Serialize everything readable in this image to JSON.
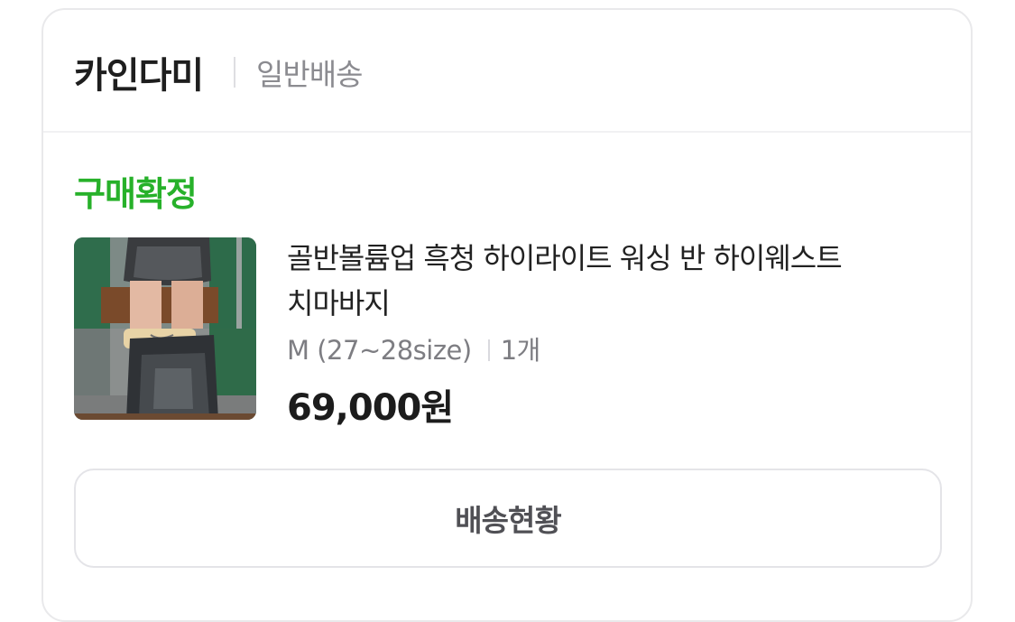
{
  "seller": {
    "name": "카인다미",
    "shipping_type": "일반배송"
  },
  "order": {
    "status": "구매확정",
    "status_color": "#27b12a",
    "product": {
      "name": "골반볼륨업 흑청 하이라이트 워싱 반 하이웨스트 치마바지",
      "option": "M (27~28size)",
      "quantity": "1개",
      "price": "69,000원",
      "thumbnail_icon": "product-photo-denim-skirt"
    }
  },
  "actions": {
    "track_label": "배송현황"
  }
}
